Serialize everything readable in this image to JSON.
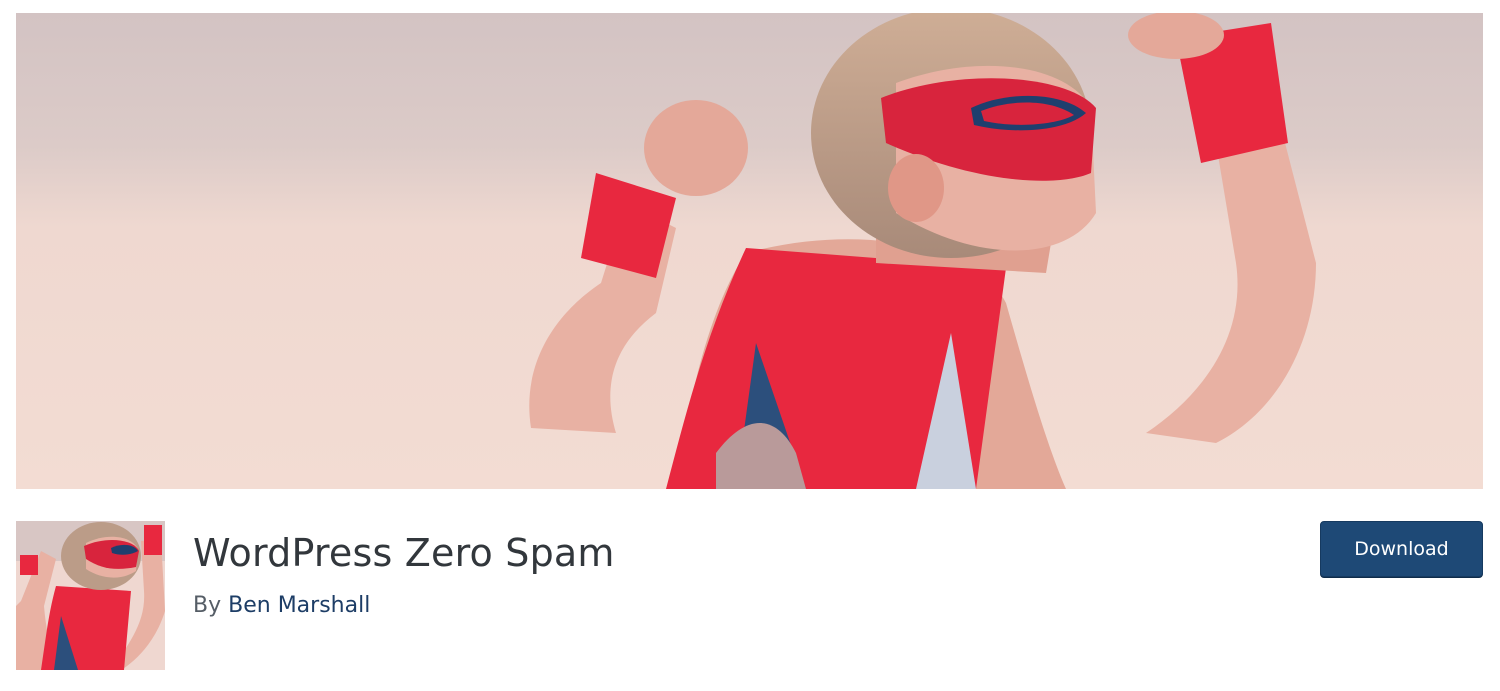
{
  "banner": {
    "alt": "Child in red superhero cape and mask flexing arms"
  },
  "plugin": {
    "name": "WordPress Zero Spam",
    "byline_prefix": "By",
    "author": "Ben Marshall",
    "icon": {
      "alt": "Superhero kid plugin icon"
    }
  },
  "actions": {
    "download_label": "Download"
  },
  "colors": {
    "button_bg": "#1e4976",
    "title": "#32373c",
    "author_link": "#1d3d66",
    "cape_red": "#e8283f"
  }
}
